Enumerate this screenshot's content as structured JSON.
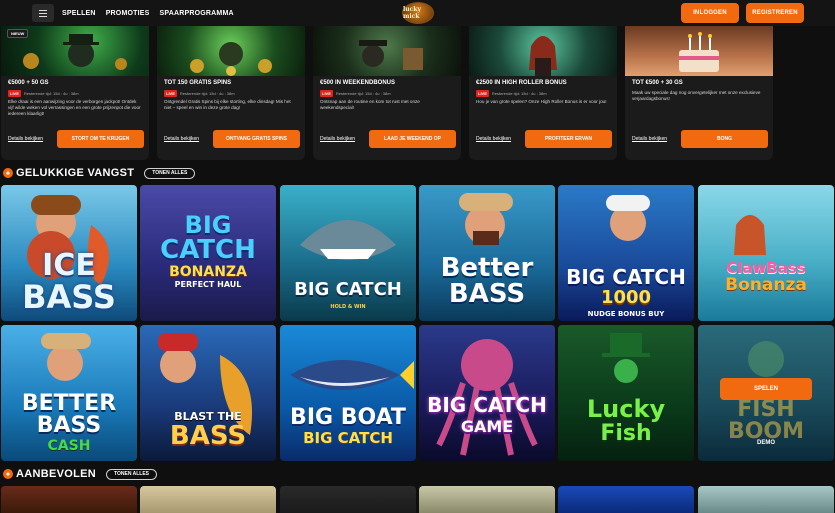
{
  "nav": {
    "links": [
      "SPELLEN",
      "PROMOTIES",
      "SPAARPROGRAMMA"
    ],
    "logo_text": "lucky mick",
    "login_label": "INLOGGEN",
    "register_label": "REGISTREREN"
  },
  "promos": [
    {
      "badge": "NIEUW",
      "title": "€5000 + 50 GS",
      "live": "LIVE",
      "time": "Resterende tijd: 15d : 4u : 38m",
      "desc": "Elke draai is een aanwijzing voor de verborgen jackpot! Ontdek vijf wilde weken vol verrassingen en een grote prijzenpot die voor iedereen klaarligt!",
      "details": "Details bekijken",
      "cta": "STORT OM TE KRIJGEN"
    },
    {
      "title": "TOT 150 GRATIS SPINS",
      "live": "LIVE",
      "time": "Resterende tijd: 15d : 4u : 38m",
      "desc": "Ontgrendel Gratis Spins bij elke storting, elke dinsdag! Mis het niet – speel en win in deze grote dag!",
      "details": "Details bekijken",
      "cta": "ONTVANG GRATIS SPINS"
    },
    {
      "title": "€500 IN WEEKENDBONUS",
      "live": "LIVE",
      "time": "Resterende tijd: 15d : 4u : 38m",
      "desc": "Ontsnap aan de routine en kom tot rust met onze weekendspecial!",
      "details": "Details bekijken",
      "cta": "LAAD JE WEEKEND OP"
    },
    {
      "title": "€2500 IN HIGH ROLLER BONUS",
      "live": "LIVE",
      "time": "Resterende tijd: 15d : 4u : 38m",
      "desc": "Hou je van grote spelen? Onze High Roller Bonus is er voor jou!",
      "details": "Details bekijken",
      "cta": "PROFITEER ERVAN"
    },
    {
      "title": "TOT €500 + 30 GS",
      "desc": "Maak uw speciale dag nog onvergetelijker met onze exclusieve verjaardagsbonus!",
      "details": "Details bekijken",
      "cta": "BONG"
    }
  ],
  "section1": {
    "title": "GELUKKIGE VANGST",
    "show_all": "TONEN ALLES"
  },
  "section2": {
    "title": "AANBEVOLEN",
    "show_all": "TONEN ALLES"
  },
  "games_row1": [
    {
      "title": "ICE",
      "title2": "BASS"
    },
    {
      "title": "BIG",
      "title2": "CATCH",
      "sub": "BONANZA",
      "sub2": "PERFECT HAUL"
    },
    {
      "title": "BIG CATCH",
      "sub": "HOLD & WIN"
    },
    {
      "title": "Better",
      "title2": "BASS"
    },
    {
      "title": "BIG CATCH",
      "title2": "1000",
      "sub": "NUDGE BONUS BUY"
    },
    {
      "title": "ClawBass",
      "title2": "Bonanza"
    }
  ],
  "games_row2": [
    {
      "title": "BETTER",
      "title2": "BASS",
      "sub": "CASH"
    },
    {
      "title": "BLAST THE",
      "title2": "BASS"
    },
    {
      "title": "BIG BOAT",
      "title2": "BIG CATCH"
    },
    {
      "title": "BIG CATCH",
      "title2": "GAME"
    },
    {
      "title": "Lucky",
      "title2": "Fish"
    },
    {
      "title": "FISH",
      "title2": "BOOM",
      "play": "SPELEN",
      "demo": "DEMO"
    }
  ]
}
